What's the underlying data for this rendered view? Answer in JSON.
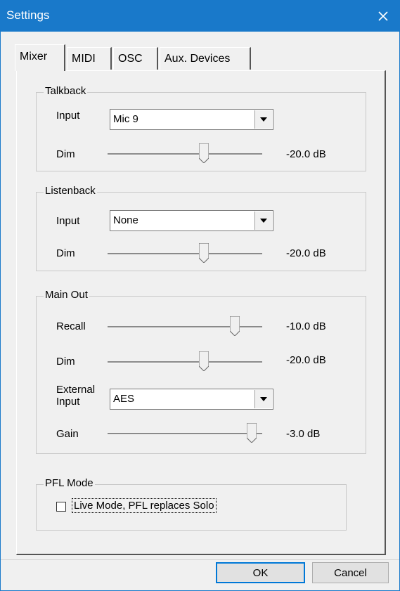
{
  "window": {
    "title": "Settings"
  },
  "tabs": [
    {
      "label": "Mixer"
    },
    {
      "label": "MIDI"
    },
    {
      "label": "OSC"
    },
    {
      "label": "Aux. Devices"
    }
  ],
  "talkback": {
    "label": "Talkback",
    "input_label": "Input",
    "input_value": "Mic 9",
    "dim_label": "Dim",
    "dim_value": "-20.0 dB"
  },
  "listenback": {
    "label": "Listenback",
    "input_label": "Input",
    "input_value": "None",
    "dim_label": "Dim",
    "dim_value": "-20.0 dB"
  },
  "main_out": {
    "label": "Main Out",
    "recall_label": "Recall",
    "recall_value": "-10.0 dB",
    "dim_label": "Dim",
    "dim_value": "-20.0 dB",
    "external_input_label_1": "External",
    "external_input_label_2": "Input",
    "external_input_value": "AES",
    "gain_label": "Gain",
    "gain_value": "-3.0 dB"
  },
  "pfl_mode": {
    "label": "PFL Mode",
    "live_mode_label": "Live Mode,  PFL replaces Solo",
    "live_mode_checked": false
  },
  "buttons": {
    "ok": "OK",
    "cancel": "Cancel"
  }
}
